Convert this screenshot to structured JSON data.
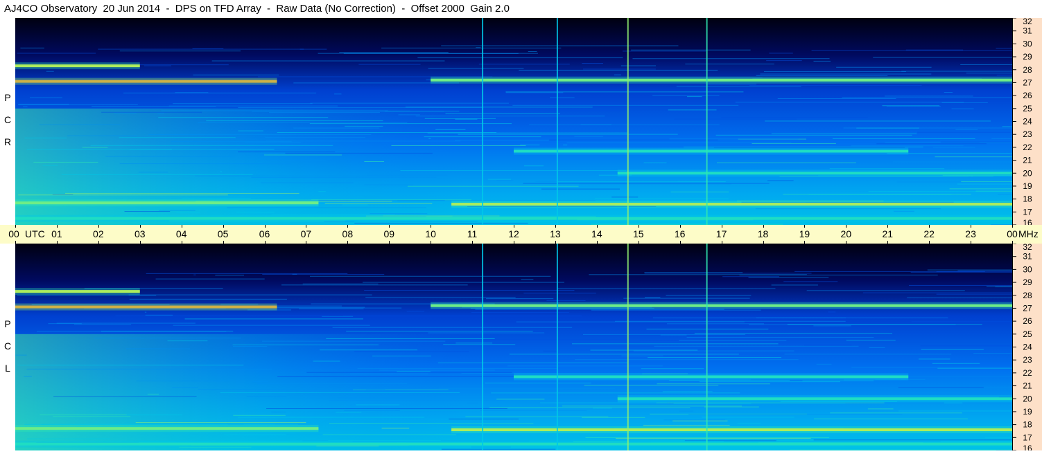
{
  "title": "AJ4CO Observatory  20 Jun 2014  -  DPS on TFD Array  -  Raw Data (No Correction)  -  Offset 2000  Gain 2.0",
  "chart_data": {
    "type": "heatmap",
    "title": "AJ4CO Observatory  20 Jun 2014  -  DPS on TFD Array  -  Raw Data (No Correction)  -  Offset 2000  Gain 2.0",
    "x_unit_label": "UTC",
    "y_unit_label": "MHz",
    "xlim": [
      0,
      24
    ],
    "ylim": [
      16,
      32
    ],
    "x_ticks": [
      "00",
      "01",
      "02",
      "03",
      "04",
      "05",
      "06",
      "07",
      "08",
      "09",
      "10",
      "11",
      "12",
      "13",
      "14",
      "15",
      "16",
      "17",
      "18",
      "19",
      "20",
      "21",
      "22",
      "23",
      "00"
    ],
    "y_ticks": [
      "16",
      "17",
      "18",
      "19",
      "20",
      "21",
      "22",
      "23",
      "24",
      "25",
      "26",
      "27",
      "28",
      "29",
      "30",
      "31",
      "32"
    ],
    "panels": [
      {
        "name": "RCP",
        "letters": [
          "R",
          "C",
          "P"
        ]
      },
      {
        "name": "LCP",
        "letters": [
          "L",
          "C",
          "P"
        ]
      }
    ],
    "colormap": [
      "#00001a",
      "#0010a0",
      "#0050e0",
      "#0090f0",
      "#00c8e8",
      "#30e8b0",
      "#90f070",
      "#f0f030",
      "#f09030",
      "#f03090"
    ],
    "bands": [
      {
        "t0": 0.0,
        "t1": 6.3,
        "f": 27.1,
        "level": 0.9
      },
      {
        "t0": 0.0,
        "t1": 3.0,
        "f": 28.3,
        "level": 0.75
      },
      {
        "t0": 0.0,
        "t1": 7.3,
        "f": 17.7,
        "level": 0.7
      },
      {
        "t0": 10.5,
        "t1": 24.0,
        "f": 17.6,
        "level": 0.75
      },
      {
        "t0": 10.0,
        "t1": 24.0,
        "f": 27.2,
        "level": 0.65
      },
      {
        "t0": 12.0,
        "t1": 21.5,
        "f": 21.7,
        "level": 0.6
      },
      {
        "t0": 0.0,
        "t1": 24.0,
        "f": 16.5,
        "level": 0.55
      },
      {
        "t0": 14.5,
        "t1": 24.0,
        "f": 20.0,
        "level": 0.5
      }
    ],
    "spikes": [
      {
        "t": 11.25,
        "level": 0.4
      },
      {
        "t": 13.05,
        "level": 0.45
      },
      {
        "t": 14.75,
        "level": 0.7
      },
      {
        "t": 16.65,
        "level": 0.6
      }
    ]
  }
}
